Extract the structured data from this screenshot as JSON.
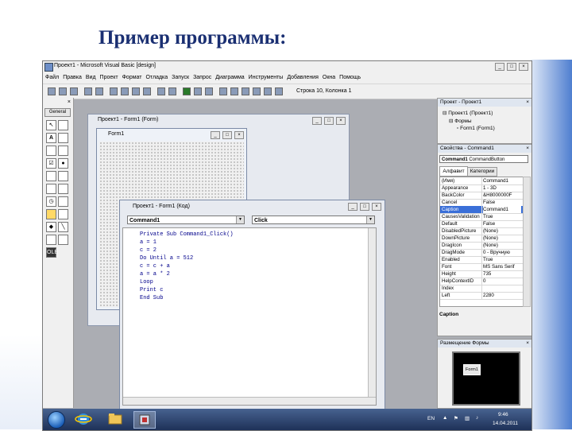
{
  "slide_title": "Пример программы:",
  "window": {
    "title": "Проект1 - Microsoft Visual Basic [design]",
    "menu": [
      "Файл",
      "Правка",
      "Вид",
      "Проект",
      "Формат",
      "Отладка",
      "Запуск",
      "Запрос",
      "Диаграмма",
      "Инструменты",
      "Добавления",
      "Окна",
      "Помощь"
    ],
    "cursor_position": "Строка 10, Колонка 1"
  },
  "toolbox": {
    "header": "General"
  },
  "form_designer": {
    "title": "Проект1 - Form1 (Form)",
    "form_caption": "Form1"
  },
  "code_window": {
    "title": "Проект1 - Form1 (Код)",
    "object_combo": "Command1",
    "procedure_combo": "Click",
    "lines": [
      "Private Sub Command1_Click()",
      "a = 1",
      "c = 2",
      "Do Until a = 512",
      "c = c + a",
      "a = a * 2",
      "Loop",
      "Print c",
      "End Sub"
    ]
  },
  "project_panel": {
    "title": "Проект - Проект1",
    "tree": [
      "Проект1 (Проект1)",
      "Формы",
      "Form1 (Form1)"
    ]
  },
  "properties_panel": {
    "title": "Свойства - Command1",
    "object": "Command1",
    "object_type": "CommandButton",
    "tabs": [
      "Алфавит",
      "Категории"
    ],
    "rows": [
      {
        "name": "(Имя)",
        "value": "Command1"
      },
      {
        "name": "Appearance",
        "value": "1 - 3D"
      },
      {
        "name": "BackColor",
        "value": "&H8000000F"
      },
      {
        "name": "Cancel",
        "value": "False"
      },
      {
        "name": "Caption",
        "value": "Command1"
      },
      {
        "name": "CausesValidation",
        "value": "True"
      },
      {
        "name": "Default",
        "value": "False"
      },
      {
        "name": "DisabledPicture",
        "value": "(None)"
      },
      {
        "name": "DownPicture",
        "value": "(None)"
      },
      {
        "name": "DragIcon",
        "value": "(None)"
      },
      {
        "name": "DragMode",
        "value": "0 - Вручную"
      },
      {
        "name": "Enabled",
        "value": "True"
      },
      {
        "name": "Font",
        "value": "MS Sans Serif"
      },
      {
        "name": "Height",
        "value": "735"
      },
      {
        "name": "HelpContextID",
        "value": "0"
      },
      {
        "name": "Index",
        "value": ""
      },
      {
        "name": "Left",
        "value": "2280"
      }
    ],
    "selected_row": "Caption",
    "description_title": "Caption"
  },
  "layout_panel": {
    "title": "Размещение Формы",
    "form_label": "Form1"
  },
  "taskbar": {
    "lang": "EN",
    "time": "9:46",
    "date": "14.04.2011"
  },
  "colors": {
    "title_text": "#1a2f72",
    "selection": "#3a6fd8",
    "code_text": "#00008b"
  }
}
